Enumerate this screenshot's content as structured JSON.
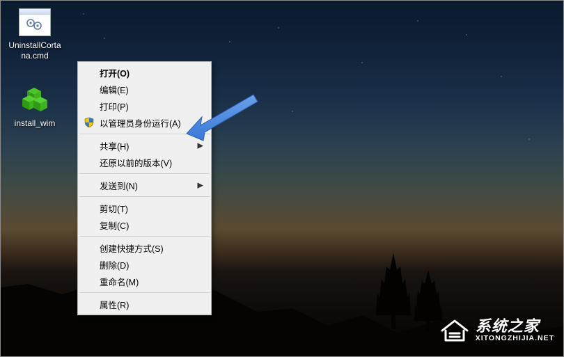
{
  "desktop": {
    "icons": [
      {
        "id": "uninstall-cortana",
        "label": "UninstallCortana.cmd"
      },
      {
        "id": "install-wim",
        "label": "install_wim"
      }
    ]
  },
  "context_menu": {
    "groups": [
      [
        {
          "id": "open",
          "label": "打开(O)",
          "bold": true
        },
        {
          "id": "edit",
          "label": "编辑(E)"
        },
        {
          "id": "print",
          "label": "打印(P)"
        },
        {
          "id": "runas",
          "label": "以管理员身份运行(A)",
          "shield": true
        }
      ],
      [
        {
          "id": "share",
          "label": "共享(H)",
          "submenu": true
        },
        {
          "id": "restore",
          "label": "还原以前的版本(V)"
        }
      ],
      [
        {
          "id": "sendto",
          "label": "发送到(N)",
          "submenu": true
        }
      ],
      [
        {
          "id": "cut",
          "label": "剪切(T)"
        },
        {
          "id": "copy",
          "label": "复制(C)"
        }
      ],
      [
        {
          "id": "shortcut",
          "label": "创建快捷方式(S)"
        },
        {
          "id": "delete",
          "label": "删除(D)"
        },
        {
          "id": "rename",
          "label": "重命名(M)"
        }
      ],
      [
        {
          "id": "props",
          "label": "属性(R)"
        }
      ]
    ]
  },
  "annotation": {
    "arrow_color": "#3b78d8",
    "target": "context_menu.groups.0.3"
  },
  "watermark": {
    "title": "系统之家",
    "sub": "XITONGZHIJIA.NET"
  }
}
